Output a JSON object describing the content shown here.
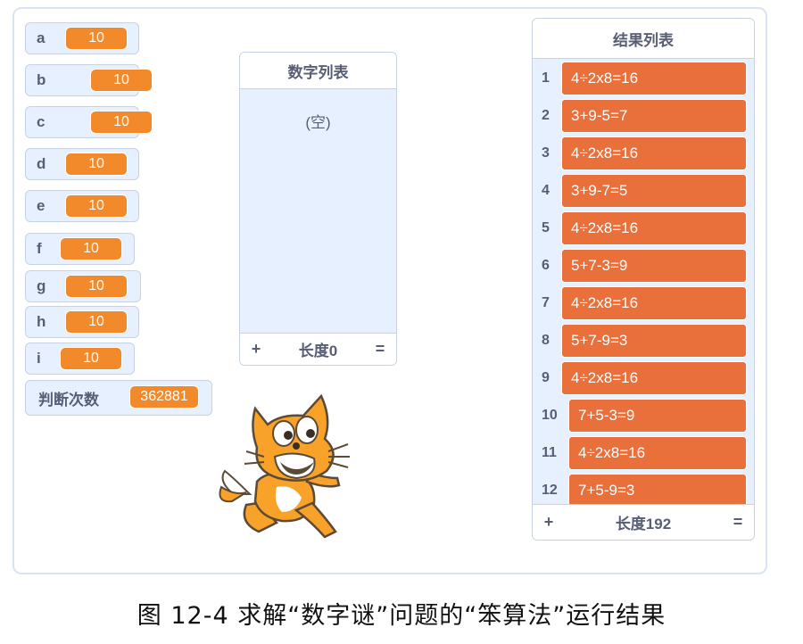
{
  "variables": [
    {
      "name": "a",
      "value": "10"
    },
    {
      "name": "b",
      "value": "10"
    },
    {
      "name": "c",
      "value": "10"
    },
    {
      "name": "d",
      "value": "10"
    },
    {
      "name": "e",
      "value": "10"
    },
    {
      "name": "f",
      "value": "10"
    },
    {
      "name": "g",
      "value": "10"
    },
    {
      "name": "h",
      "value": "10"
    },
    {
      "name": "i",
      "value": "10"
    },
    {
      "name": "判断次数",
      "value": "362881"
    }
  ],
  "number_list": {
    "title": "数字列表",
    "empty_text": "(空)",
    "add": "+",
    "length_label": "长度0",
    "resize": "="
  },
  "result_list": {
    "title": "结果列表",
    "add": "+",
    "length_label": "长度192",
    "resize": "=",
    "items": [
      {
        "index": "1",
        "value": "4÷2x8=16"
      },
      {
        "index": "2",
        "value": "3+9-5=7"
      },
      {
        "index": "3",
        "value": "4÷2x8=16"
      },
      {
        "index": "4",
        "value": "3+9-7=5"
      },
      {
        "index": "5",
        "value": "4÷2x8=16"
      },
      {
        "index": "6",
        "value": "5+7-3=9"
      },
      {
        "index": "7",
        "value": "4÷2x8=16"
      },
      {
        "index": "8",
        "value": "5+7-9=3"
      },
      {
        "index": "9",
        "value": "4÷2x8=16"
      },
      {
        "index": "10",
        "value": "7+5-3=9"
      },
      {
        "index": "11",
        "value": "4÷2x8=16"
      },
      {
        "index": "12",
        "value": "7+5-9=3"
      }
    ]
  },
  "sprite": {
    "icon": "scratch-cat-sprite"
  },
  "caption": "图 12-4 求解“数字谜”问题的“笨算法”运行结果"
}
